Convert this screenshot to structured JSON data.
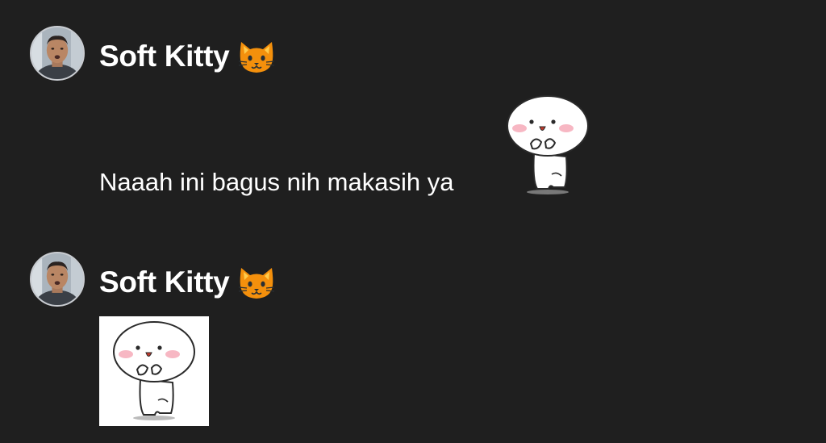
{
  "messages": [
    {
      "username": "Soft Kitty",
      "username_icon": "cat-face-icon",
      "text": "Naaah ini bagus nih makasih ya",
      "sticker_icon": "white-blob-sticker-icon"
    },
    {
      "username": "Soft Kitty",
      "username_icon": "cat-face-icon",
      "sticker_icon": "white-blob-sticker-icon"
    }
  ],
  "colors": {
    "background": "#1f1f1f",
    "text": "#ffffff",
    "cat_emoji": "#f4900c",
    "blush": "#f7b7c3"
  }
}
